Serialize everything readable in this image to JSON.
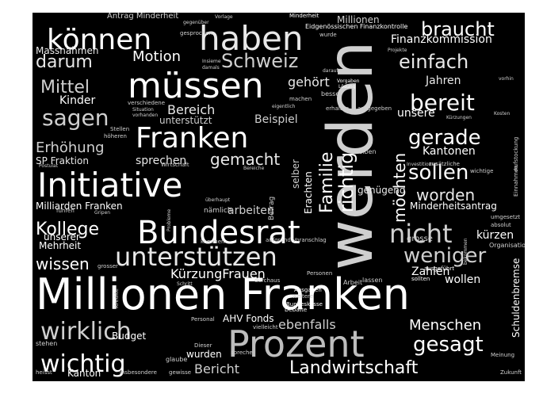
{
  "image": {
    "kind": "word cloud",
    "background": "#000000",
    "palette": [
      "#ffffff",
      "#e8e8e8",
      "#cfcfcf",
      "#bdbdbd",
      "#9a9a9a"
    ]
  },
  "words": [
    "Millionen Franken",
    "werden",
    "Prozent",
    "müssen",
    "Initiative",
    "Bundesrat",
    "haben",
    "können",
    "Franken",
    "nicht",
    "unterstützen",
    "wirklich",
    "wichtig",
    "Landwirtschaft",
    "Schweiz",
    "sagen",
    "braucht",
    "gesagt",
    "einfach",
    "bereit",
    "sollen",
    "gerade",
    "weniger",
    "worden",
    "darum",
    "Kollege",
    "wissen",
    "Menschen",
    "Mittel",
    "Motion",
    "Familie",
    "richtig",
    "möchten",
    "Bericht",
    "Erhöhung",
    "Bereich",
    "gemacht",
    "KürzungFrauen",
    "Milliarden Franken",
    "Kantonen",
    "Finanzkommission",
    "Millionen",
    "ebenfalls",
    "Schuldenbremse",
    "sprechen",
    "arbeiten",
    "gehört",
    "unsere",
    "Kanton",
    "SP Fraktion",
    "Zahlen",
    "wollen",
    "Beispiel",
    "Jahren",
    "Kinder",
    "Minderheitsantrag",
    "AHV Fonds",
    "Massnahmen",
    "Mehrheit",
    "unserer",
    "Antrag Minderheit",
    "kürzen",
    "genügend",
    "wurden",
    "Budget",
    "Minderheit",
    "Vorlage",
    "gegenüber",
    "gesprochen",
    "Eidgenössischen Finanzkontrolle",
    "Projekte",
    "Ausgaben",
    "Bundeskasse",
    "Debatte",
    "Kredite",
    "Personal",
    "Dieser",
    "Schritt",
    "Gripen",
    "Betrag",
    "Vorgaben",
    "Lösung",
    "Kosten",
    "Kürzungen",
    "Investitionen",
    "Erachten",
    "überhaupt",
    "nämlich",
    "Probleme",
    "kommen",
    "aufgrund",
    "Voranschlag",
    "grosse",
    "Organisationen",
    "umgesetzt",
    "absolut",
    "ausgeführt",
    "sollten",
    "Meinung",
    "Zukunft",
    "insbesondere",
    "gewisse",
    "heisst",
    "stehen",
    "glaube",
    "spreche",
    "vielleicht",
    "weitere",
    "Personen",
    "durchaus",
    "Stellen",
    "höheren",
    "Wirtschaft",
    "Bereiche",
    "verschiedene",
    "Situation",
    "vorhanden",
    "eigentlich",
    "machen",
    "besser",
    "erhalten",
    "ausgegeben",
    "bleiben",
    "zusätzliche",
    "wichtige",
    "Aufstockung",
    "Einnahmen",
    "vorhin",
    "Postulat",
    "führen",
    "Insieme",
    "damals",
    "darauf",
    "bekommen",
    "Arbeit",
    "lassen",
    "grosser",
    "selber",
    "unterstützt",
    "wurde"
  ]
}
